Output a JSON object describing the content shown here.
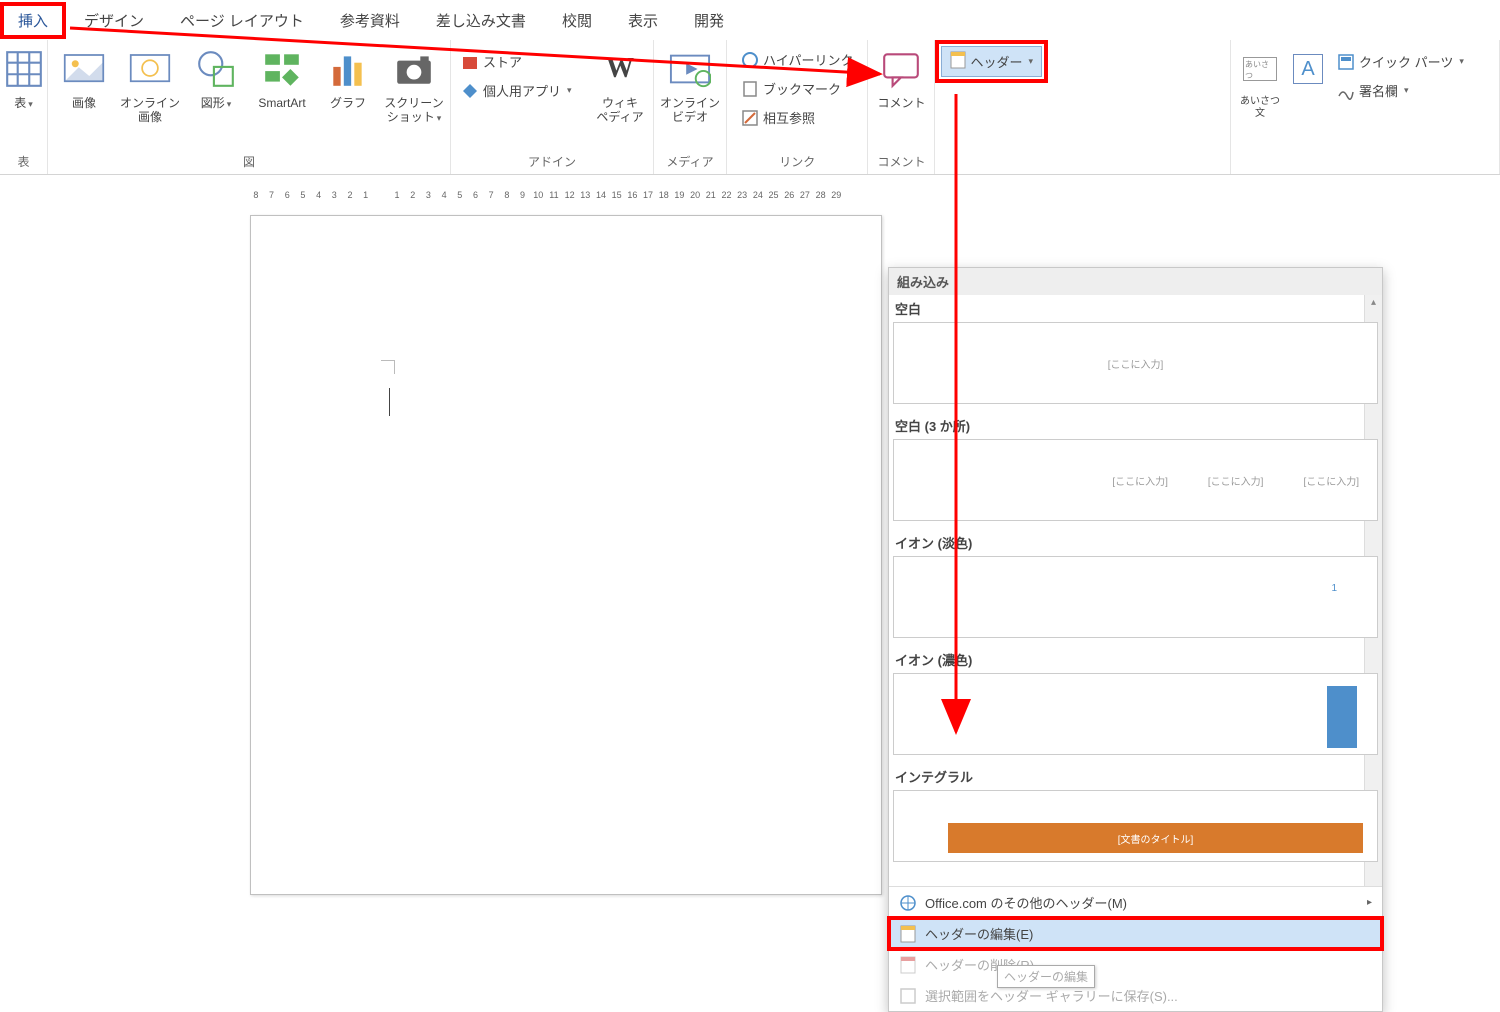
{
  "tabs": [
    "挿入",
    "デザイン",
    "ページ レイアウト",
    "参考資料",
    "差し込み文書",
    "校閲",
    "表示",
    "開発"
  ],
  "active_tab_index": 0,
  "ribbon": {
    "group_table": {
      "label": "表",
      "button": "表"
    },
    "group_figure": {
      "label": "図",
      "items": [
        "画像",
        "オンライン\n画像",
        "図形",
        "SmartArt",
        "グラフ",
        "スクリーン\nショット"
      ]
    },
    "group_addins": {
      "label": "アドイン",
      "row1": "ストア",
      "row2": "個人用アプリ",
      "wiki": "ウィキ\nペディア"
    },
    "group_media": {
      "label": "メディア",
      "button": "オンライン\nビデオ"
    },
    "group_links": {
      "label": "リンク",
      "items": [
        "ハイパーリンク",
        "ブックマーク",
        "相互参照"
      ]
    },
    "group_comment": {
      "label": "コメント",
      "button": "コメント"
    },
    "header_btn": "ヘッダー",
    "greeting": "あいさつ\n文",
    "textbox": "A",
    "quickparts": "クイック パーツ",
    "signature": "署名欄"
  },
  "ruler_ticks": [
    8,
    7,
    6,
    5,
    4,
    3,
    2,
    1,
    "",
    1,
    2,
    3,
    4,
    5,
    6,
    7,
    8,
    9,
    10,
    11,
    12,
    13,
    14,
    15,
    16,
    17,
    18,
    19,
    20,
    21,
    22,
    23,
    24,
    25,
    26,
    27,
    28,
    29
  ],
  "gallery": {
    "header": "組み込み",
    "templates": [
      {
        "name": "空白",
        "placeholders": [
          "[ここに入力]"
        ],
        "style": "single-center"
      },
      {
        "name": "空白 (3 か所)",
        "placeholders": [
          "[ここに入力]",
          "[ここに入力]",
          "[ここに入力]"
        ],
        "style": "triple-right"
      },
      {
        "name": "イオン (淡色)",
        "placeholders": [
          "1"
        ],
        "style": "right-num"
      },
      {
        "name": "イオン (濃色)",
        "placeholders": [],
        "style": "blue-bar"
      },
      {
        "name": "インテグラル",
        "placeholders": [
          "[文書のタイトル]"
        ],
        "style": "orange-bar"
      }
    ],
    "footer_items": [
      {
        "label": "Office.com のその他のヘッダー(M)",
        "icon": "globe-icon",
        "chevron": true,
        "disabled": false
      },
      {
        "label": "ヘッダーの編集(E)",
        "icon": "page-icon",
        "highlighted": true
      },
      {
        "label": "ヘッダーの削除(R)",
        "icon": "page-red-icon",
        "disabled": true
      },
      {
        "label": "選択範囲をヘッダー ギャラリーに保存(S)...",
        "icon": "save-icon",
        "disabled": true
      }
    ],
    "tooltip": "ヘッダーの編集"
  }
}
